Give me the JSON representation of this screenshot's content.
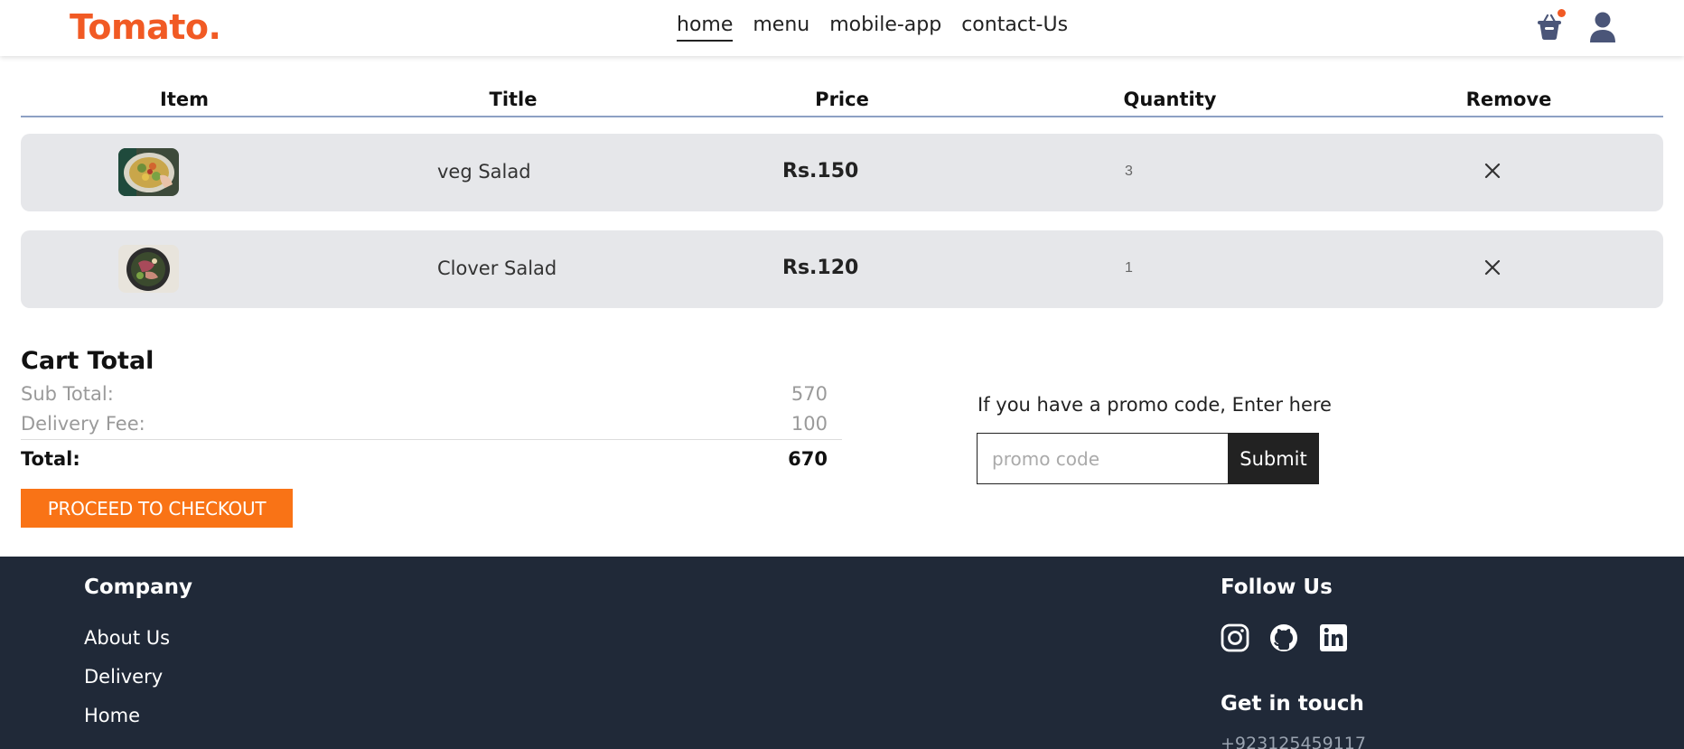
{
  "nav": {
    "logo": "Tomato.",
    "links": [
      "home",
      "menu",
      "mobile-app",
      "contact-Us"
    ],
    "active_link": "home",
    "cart_icon": "basket-icon",
    "cart_badge_color": "#f15a24",
    "profile_icon": "user-icon"
  },
  "cart": {
    "headers": [
      "Item",
      "Title",
      "Price",
      "Quantity",
      "Remove"
    ],
    "items": [
      {
        "title": "veg Salad",
        "price": "Rs.150",
        "quantity": "3",
        "image_icon": "salad-photo"
      },
      {
        "title": "Clover Salad",
        "price": "Rs.120",
        "quantity": "1",
        "image_icon": "salad-photo"
      }
    ],
    "remove_icon": "close-icon"
  },
  "totals": {
    "heading": "Cart Total",
    "subtotal_label": "Sub Total:",
    "subtotal_value": "570",
    "delivery_label": "Delivery Fee:",
    "delivery_value": "100",
    "total_label": "Total:",
    "total_value": "670",
    "checkout_label": "PROCEED TO CHECKOUT",
    "checkout_color": "#f97316"
  },
  "promo": {
    "label": "If you have a promo code, Enter here",
    "placeholder": "promo code",
    "value": "",
    "submit_label": "Submit"
  },
  "footer": {
    "background": "#202938",
    "company_heading": "Company",
    "company_links": [
      "About Us",
      "Delivery",
      "Home"
    ],
    "follow_heading": "Follow Us",
    "social_icons": [
      "instagram-icon",
      "github-icon",
      "linkedin-icon"
    ],
    "contact_heading": "Get in touch",
    "phone": "+923125459117"
  }
}
